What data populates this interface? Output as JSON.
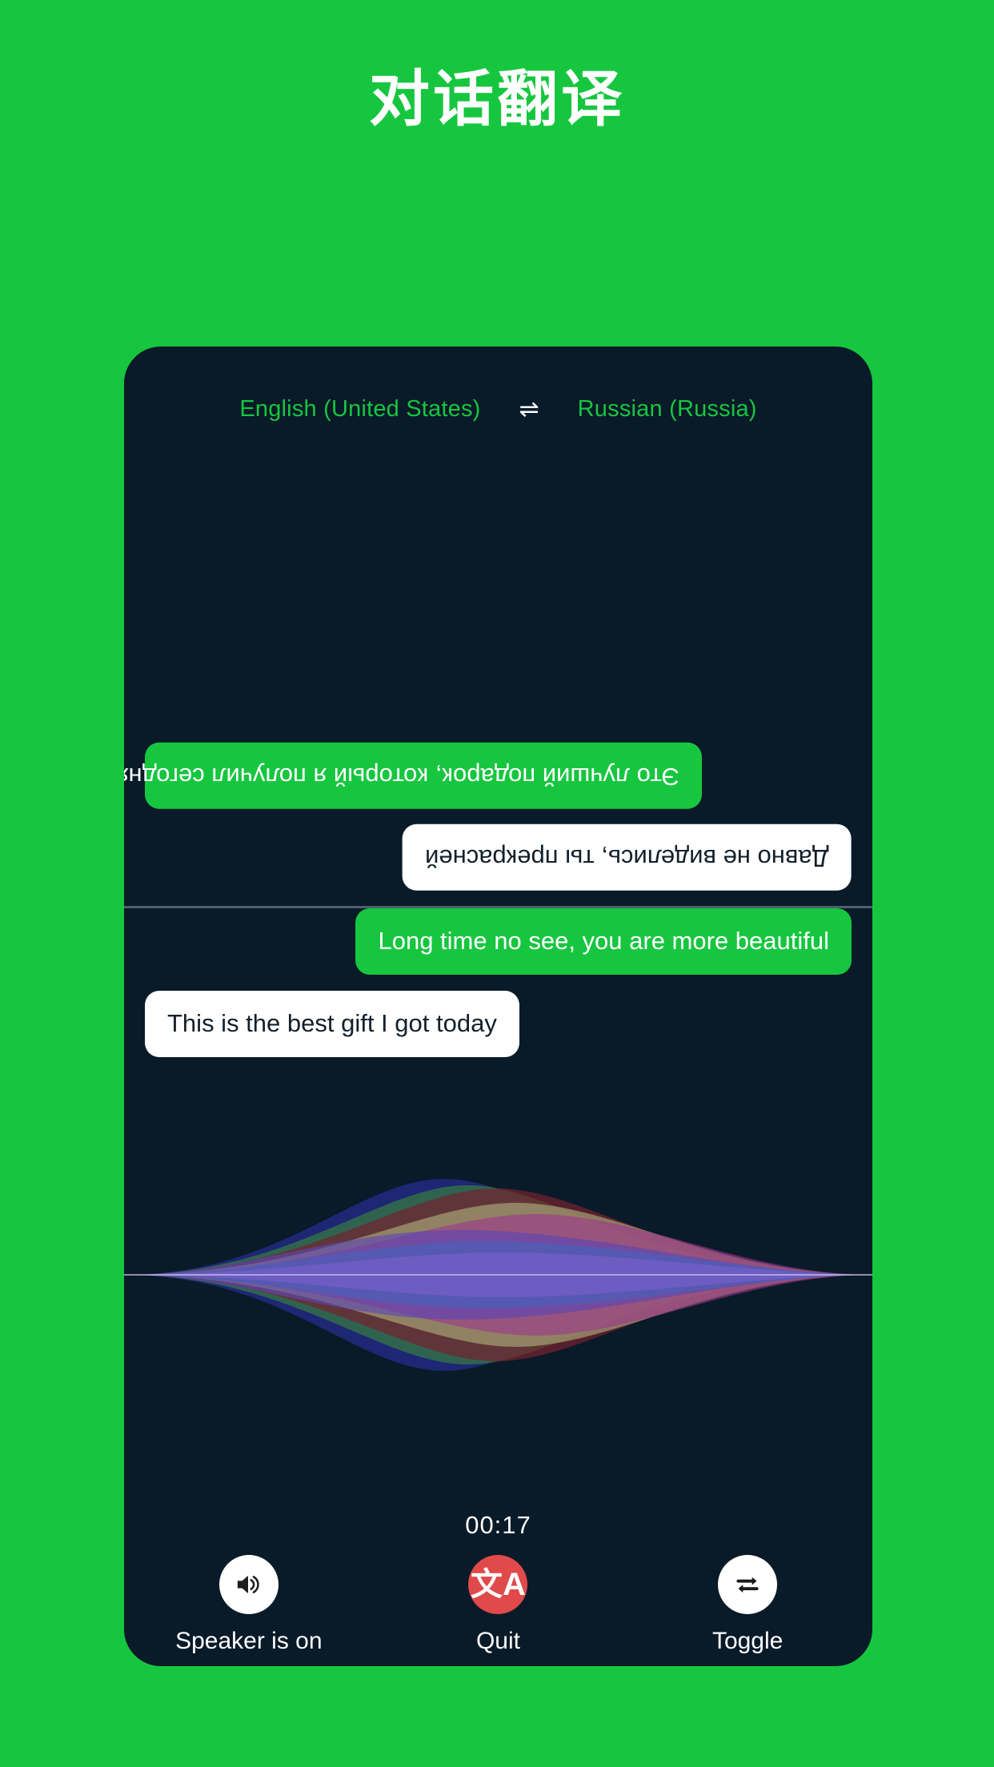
{
  "page": {
    "title": "对话翻译",
    "background_color": "#16c63f",
    "panel_color": "#091a28"
  },
  "languages": {
    "source": "English (United States)",
    "swap_icon": "⇌",
    "target": "Russian (Russia)",
    "accent_color": "#16c63f"
  },
  "conversation": {
    "far_speaker": {
      "orientation": "rotated-180",
      "messages": [
        {
          "text": "Это лучший подарок, который я получил сегодня",
          "style": "green",
          "align": "left"
        },
        {
          "text": "Давно не виделись, ты прекрасней",
          "style": "white",
          "align": "right"
        }
      ]
    },
    "near_speaker": {
      "orientation": "normal",
      "messages": [
        {
          "text": "Long time no see, you are more beautiful",
          "style": "green",
          "align": "right"
        },
        {
          "text": "This is the best gift I got today",
          "style": "white",
          "align": "left"
        }
      ]
    }
  },
  "waveform": {
    "label": "audio-waveform-visualization",
    "colors": [
      "#2a2f9e",
      "#3e8f46",
      "#8a2430",
      "#c8c48a",
      "#b83aa0",
      "#6a4fd0",
      "#4f6fd8"
    ]
  },
  "timer": {
    "value": "00:17"
  },
  "controls": [
    {
      "icon": "speaker-icon",
      "label": "Speaker is on",
      "circle_color": "#ffffff"
    },
    {
      "icon": "translate-icon",
      "glyph": "文A",
      "label": "Quit",
      "circle_color": "#e04a4a"
    },
    {
      "icon": "toggle-swap-icon",
      "label": "Toggle",
      "circle_color": "#ffffff"
    }
  ]
}
